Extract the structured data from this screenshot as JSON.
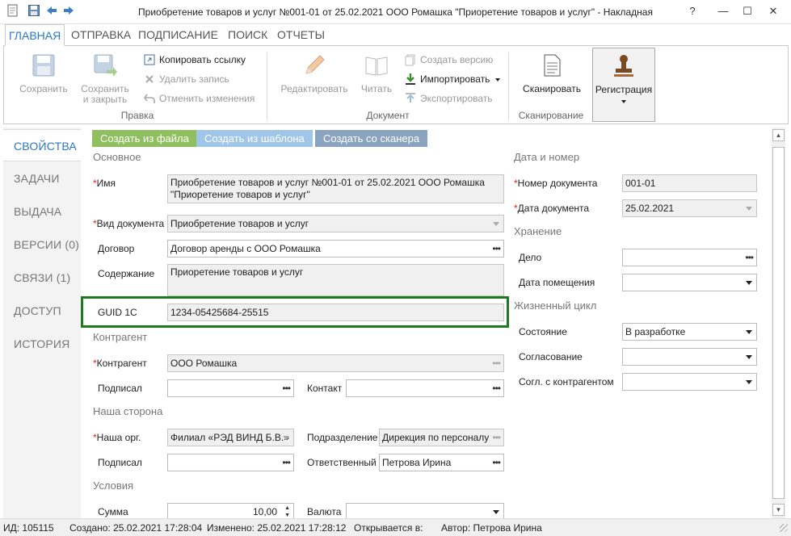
{
  "window": {
    "title": "Приобретение товаров и услуг №001-01 от 25.02.2021 ООО Ромашка \"Приоретение товаров и услуг\" - Накладная",
    "help": "?",
    "minimize": "—",
    "maximize": "☐",
    "close": "✕"
  },
  "ribbon_tabs": [
    "ГЛАВНАЯ",
    "ОТПРАВКА",
    "ПОДПИСАНИЕ",
    "ПОИСК",
    "ОТЧЕТЫ"
  ],
  "ribbon": {
    "save": "Сохранить",
    "save_close_1": "Сохранить",
    "save_close_2": "и закрыть",
    "copy_link": "Копировать ссылку",
    "delete_record": "Удалить запись",
    "undo_changes": "Отменить изменения",
    "group_edit": "Правка",
    "edit": "Редактировать",
    "read": "Читать",
    "create_version": "Создать версию",
    "import": "Импортировать",
    "export": "Экспортировать",
    "group_document": "Документ",
    "scan": "Сканировать",
    "group_scan": "Сканирование",
    "registration": "Регистрация"
  },
  "nav": [
    "СВОЙСТВА",
    "ЗАДАЧИ",
    "ВЫДАЧА",
    "ВЕРСИИ (0)",
    "СВЯЗИ (1)",
    "ДОСТУП",
    "ИСТОРИЯ"
  ],
  "create_buttons": {
    "from_file": "Создать из файла",
    "from_template": "Создать из шаблона",
    "from_scanner": "Создать со сканера"
  },
  "colors": {
    "accent": "#2b78c5",
    "from_file_bg": "#8fbf5e",
    "from_template_bg": "#9fc6e8",
    "from_scanner_bg": "#8aa3bf",
    "highlight": "#1f7a1f",
    "required": "#d9261c"
  },
  "form": {
    "section_main": "Основное",
    "name_label": "Имя",
    "name_value": "Приобретение товаров и услуг №001-01 от 25.02.2021 ООО Ромашка \"Приоретение товаров и услуг\"",
    "doc_type_label": "Вид документа",
    "doc_type_value": "Приобретение товаров и услуг",
    "contract_label": "Договор",
    "contract_value": "Договор аренды с ООО Ромашка",
    "content_label": "Содержание",
    "content_value": "Приоретение товаров и услуг",
    "guid_label": "GUID 1С",
    "guid_value": "1234-05425684-25515",
    "section_counterparty": "Контрагент",
    "counterparty_label": "Контрагент",
    "counterparty_value": "ООО Ромашка",
    "signed_label": "Подписал",
    "signed_value": "",
    "contact_label": "Контакт",
    "contact_value": "",
    "section_our_side": "Наша сторона",
    "our_org_label": "Наша орг.",
    "our_org_value": "Филиал «РЭД ВИНД Б.В.»",
    "division_label": "Подразделение",
    "division_value": "Дирекция по персоналу",
    "our_signed_label": "Подписал",
    "our_signed_value": "",
    "responsible_label": "Ответственный",
    "responsible_value": "Петрова Ирина",
    "section_conditions": "Условия",
    "sum_label": "Сумма",
    "sum_value": "10,00",
    "currency_label": "Валюта",
    "currency_value": ""
  },
  "right": {
    "section_date_number": "Дата и номер",
    "doc_number_label": "Номер документа",
    "doc_number_value": "001-01",
    "doc_date_label": "Дата документа",
    "doc_date_value": "25.02.2021",
    "section_storage": "Хранение",
    "case_label": "Дело",
    "case_value": "",
    "placement_date_label": "Дата помещения",
    "placement_date_value": "",
    "section_lifecycle": "Жизненный цикл",
    "state_label": "Состояние",
    "state_value": "В разработке",
    "approval_label": "Согласование",
    "approval_value": "",
    "cp_approval_label": "Согл. с контрагентом",
    "cp_approval_value": ""
  },
  "status": {
    "id": "ИД: 105115",
    "created": "Создано: 25.02.2021 17:28:04",
    "changed": "Изменено: 25.02.2021 17:28:12",
    "opens_in": "Открывается в:",
    "author": "Автор: Петрова Ирина"
  }
}
